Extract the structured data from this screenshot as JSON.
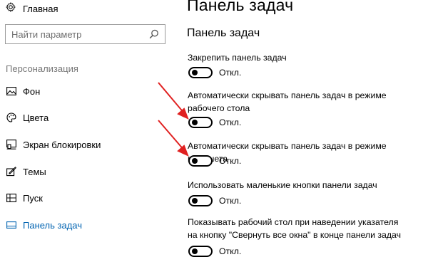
{
  "sidebar": {
    "home_label": "Главная",
    "search_placeholder": "Найти параметр",
    "section_title": "Персонализация",
    "items": [
      {
        "label": "Фон",
        "icon": "picture-icon"
      },
      {
        "label": "Цвета",
        "icon": "palette-icon"
      },
      {
        "label": "Экран блокировки",
        "icon": "lock-screen-icon"
      },
      {
        "label": "Темы",
        "icon": "themes-icon"
      },
      {
        "label": "Пуск",
        "icon": "start-icon"
      },
      {
        "label": "Панель задач",
        "icon": "taskbar-icon",
        "active": true
      }
    ]
  },
  "main": {
    "title": "Панель задач",
    "subtitle": "Панель задач",
    "settings": [
      {
        "label": "Закрепить панель задач",
        "state": "Откл."
      },
      {
        "label": "Автоматически скрывать панель задач в режиме рабочего стола",
        "state": "Откл."
      },
      {
        "label": "Автоматически скрывать панель задач в режиме планшета",
        "state": "Откл."
      },
      {
        "label": "Использовать маленькие кнопки панели задач",
        "state": "Откл."
      },
      {
        "label": "Показывать рабочий стол при наведении указателя на кнопку \"Свернуть все окна\" в конце панели задач",
        "state": "Откл."
      }
    ]
  },
  "colors": {
    "accent": "#0063b1",
    "annotation_arrow": "#e02020"
  }
}
